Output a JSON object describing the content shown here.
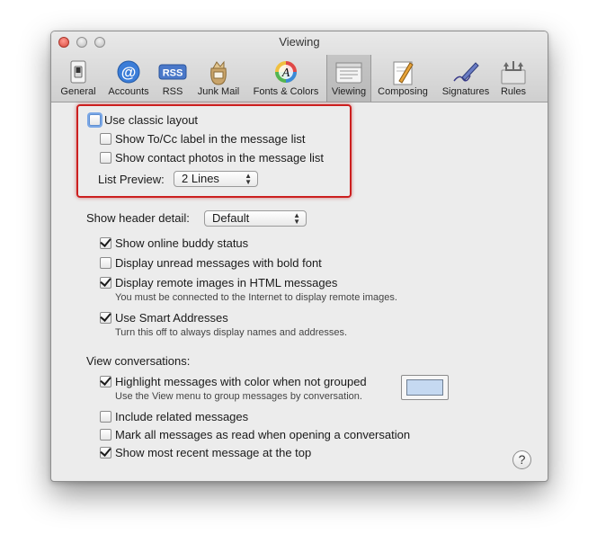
{
  "window": {
    "title": "Viewing"
  },
  "toolbar": {
    "items": [
      {
        "label": "General",
        "icon": "light-switch-icon"
      },
      {
        "label": "Accounts",
        "icon": "at-sign-icon"
      },
      {
        "label": "RSS",
        "icon": "rss-icon"
      },
      {
        "label": "Junk Mail",
        "icon": "junk-mail-bag-icon"
      },
      {
        "label": "Fonts & Colors",
        "icon": "fonts-colors-icon"
      },
      {
        "label": "Viewing",
        "icon": "viewing-icon",
        "selected": true
      },
      {
        "label": "Composing",
        "icon": "composing-pencil-icon"
      },
      {
        "label": "Signatures",
        "icon": "signature-pen-icon"
      },
      {
        "label": "Rules",
        "icon": "rules-icon"
      }
    ],
    "rss_badge": "RSS"
  },
  "layout_group": {
    "use_classic_layout": {
      "label": "Use classic layout",
      "checked": false
    },
    "show_to_cc": {
      "label": "Show To/Cc label in the message list",
      "checked": false
    },
    "show_contact_photos": {
      "label": "Show contact photos in the message list",
      "checked": false
    },
    "list_preview": {
      "label": "List Preview:",
      "value": "2 Lines"
    }
  },
  "header_detail": {
    "label": "Show header detail:",
    "value": "Default"
  },
  "options": {
    "online_buddy": {
      "label": "Show online buddy status",
      "checked": true
    },
    "unread_bold": {
      "label": "Display unread messages with bold font",
      "checked": false
    },
    "remote_images": {
      "label": "Display remote images in HTML messages",
      "checked": true,
      "note": "You must be connected to the Internet to display remote images."
    },
    "smart_addresses": {
      "label": "Use Smart Addresses",
      "checked": true,
      "note": "Turn this off to always display names and addresses."
    }
  },
  "conversations": {
    "heading": "View conversations:",
    "highlight": {
      "label": "Highlight messages with color when not grouped",
      "checked": true,
      "note": "Use the View menu to group messages by conversation.",
      "color": "#c5d9f1"
    },
    "include_related": {
      "label": "Include related messages",
      "checked": false
    },
    "mark_all_read": {
      "label": "Mark all messages as read when opening a conversation",
      "checked": false
    },
    "most_recent_top": {
      "label": "Show most recent message at the top",
      "checked": true
    }
  },
  "help": {
    "symbol": "?"
  },
  "colors": {
    "highlight_border": "#cc1f1f",
    "focus_ring": "#7aa7e6"
  }
}
